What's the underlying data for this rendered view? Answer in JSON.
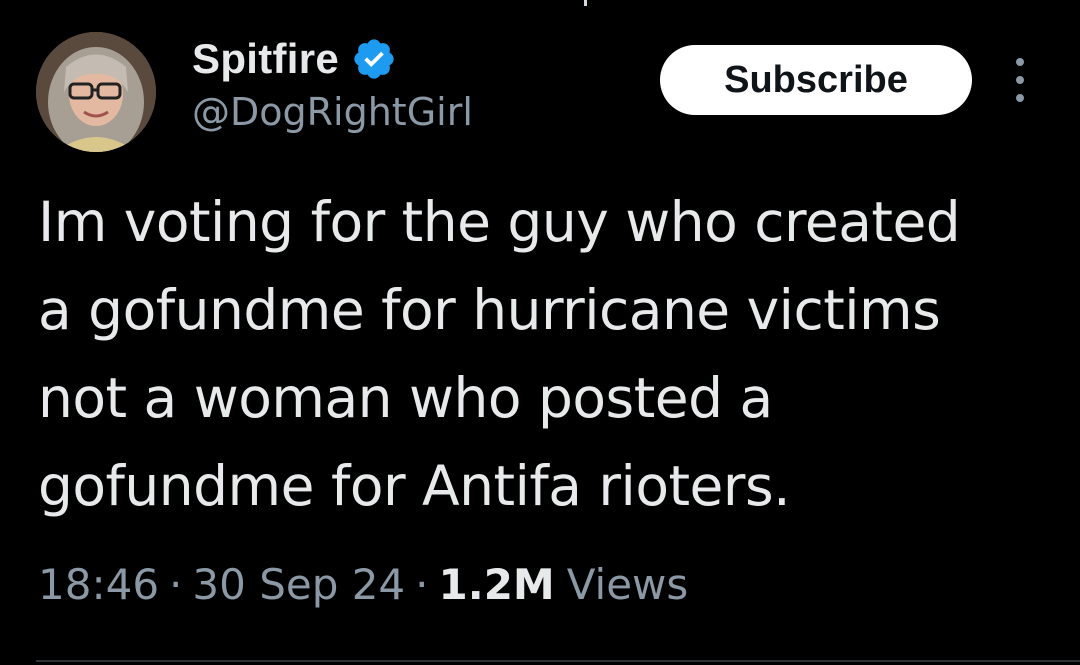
{
  "author": {
    "display_name": "Spitfire",
    "handle": "@DogRightGirl",
    "verified_icon": "verified-badge-icon",
    "verified_color": "#1d9bf0"
  },
  "actions": {
    "subscribe_label": "Subscribe",
    "more_icon": "more-vertical-icon"
  },
  "tweet": {
    "lines": [
      "Im voting for the guy who created",
      "a gofundme for hurricane victims",
      "not a woman who posted a",
      "gofundme for Antifa rioters."
    ]
  },
  "meta": {
    "time": "18:46",
    "separator": "·",
    "date": "30 Sep 24",
    "views_count": "1.2M",
    "views_label": "Views"
  },
  "colors": {
    "background": "#000000",
    "primary_text": "#e7e9ea",
    "secondary_text": "#8b98a5",
    "subscribe_bg": "#ffffff"
  }
}
